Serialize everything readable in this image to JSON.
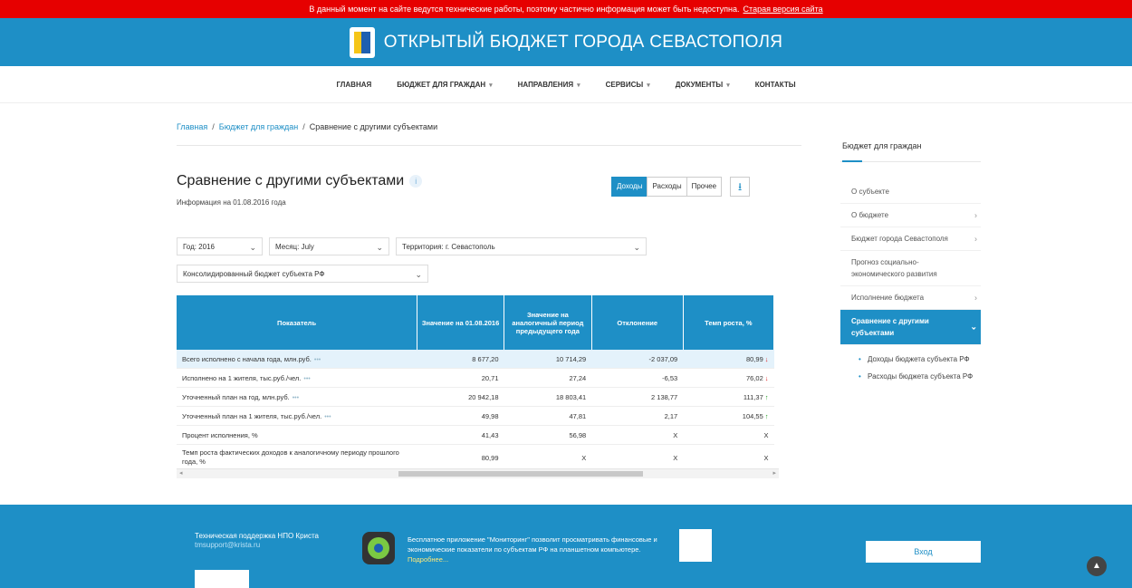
{
  "notice": {
    "text": "В данный момент на сайте ведутся технические работы, поэтому частично информация может быть недоступна.",
    "link": "Старая версия сайта"
  },
  "header": {
    "title": "ОТКРЫТЫЙ БЮДЖЕТ ГОРОДА СЕВАСТОПОЛЯ"
  },
  "nav": {
    "items": [
      {
        "label": "ГЛАВНАЯ",
        "caret": ""
      },
      {
        "label": "БЮДЖЕТ ДЛЯ ГРАЖДАН",
        "caret": "▾"
      },
      {
        "label": "НАПРАВЛЕНИЯ",
        "caret": "▾"
      },
      {
        "label": "СЕРВИСЫ",
        "caret": "▾"
      },
      {
        "label": "ДОКУМЕНТЫ",
        "caret": "▾"
      },
      {
        "label": "КОНТАКТЫ",
        "caret": ""
      }
    ]
  },
  "breadcrumb": {
    "home": "Главная",
    "sep": "/",
    "section": "Бюджет для граждан",
    "current": "Сравнение с другими субъектами"
  },
  "page": {
    "title": "Сравнение с другими субъектами",
    "info_icon": "i",
    "subtitle": "Информация на 01.08.2016 года"
  },
  "tabs": [
    {
      "label": "Доходы",
      "active": true
    },
    {
      "label": "Расходы",
      "active": false
    },
    {
      "label": "Прочее",
      "active": false
    }
  ],
  "download_icon": "⭳",
  "filters": {
    "year": "Год: 2016",
    "month": "Месяц: July",
    "territory": "Территория: г. Севастополь",
    "budget": "Консолидированный бюджет субъекта РФ",
    "chevron": "⌄"
  },
  "table": {
    "headers": [
      "Показатель",
      "Значение на 01.08.2016",
      "Значение на аналогичный период предыдущего года",
      "Отклонение",
      "Темп роста, %"
    ],
    "rows": [
      {
        "name": "Всего исполнено с начала года, млн.руб.",
        "dots": "•••",
        "v1": "8 677,20",
        "v2": "10 714,29",
        "dev": "-2 037,09",
        "rate": "80,99",
        "trend": "↓",
        "dir": "down"
      },
      {
        "name": "Исполнено на 1 жителя, тыс.руб./чел.",
        "dots": "•••",
        "v1": "20,71",
        "v2": "27,24",
        "dev": "-6,53",
        "rate": "76,02",
        "trend": "↓",
        "dir": "down"
      },
      {
        "name": "Уточненный план на год, млн.руб.",
        "dots": "•••",
        "v1": "20 942,18",
        "v2": "18 803,41",
        "dev": "2 138,77",
        "rate": "111,37",
        "trend": "↑",
        "dir": "up"
      },
      {
        "name": "Уточненный план на 1 жителя, тыс.руб./чел.",
        "dots": "•••",
        "v1": "49,98",
        "v2": "47,81",
        "dev": "2,17",
        "rate": "104,55",
        "trend": "↑",
        "dir": "up"
      },
      {
        "name": "Процент исполнения, %",
        "dots": "",
        "v1": "41,43",
        "v2": "56,98",
        "dev": "X",
        "rate": "X",
        "trend": "",
        "dir": ""
      },
      {
        "name": "Темп роста фактических доходов к аналогичному периоду прошлого года, %",
        "dots": "",
        "v1": "80,99",
        "v2": "X",
        "dev": "X",
        "rate": "X",
        "trend": "",
        "dir": ""
      }
    ],
    "scroll_left": "◂",
    "scroll_right": "▸"
  },
  "sidebar": {
    "title": "Бюджет для граждан",
    "items": [
      {
        "label": "О субъекте",
        "arrow": ""
      },
      {
        "label": "О бюджете",
        "arrow": "›"
      },
      {
        "label": "Бюджет города Севастополя",
        "arrow": "›"
      },
      {
        "label": "Прогноз социально-экономического развития",
        "arrow": ""
      },
      {
        "label": "Исполнение бюджета",
        "arrow": "›"
      },
      {
        "label": "Сравнение с другими субъектами",
        "arrow": "⌄",
        "active": true
      }
    ],
    "subitems": [
      "Доходы бюджета субъекта РФ",
      "Расходы бюджета субъекта РФ"
    ]
  },
  "footer": {
    "support_title": "Техническая поддержка НПО Криста",
    "support_email": "tmsupport@krista.ru",
    "app_text": "Бесплатное приложение \"Мониторинг\" позволит просматривать финансовые и экономические показатели по субъектам РФ на планшетном компьютере.",
    "app_more": "Подробнее...",
    "login": "Вход"
  },
  "to_top_icon": "▲",
  "colors": {
    "brand": "#1e8fc6",
    "notice": "#e60000",
    "down": "#e02020",
    "up": "#2aa02a"
  }
}
